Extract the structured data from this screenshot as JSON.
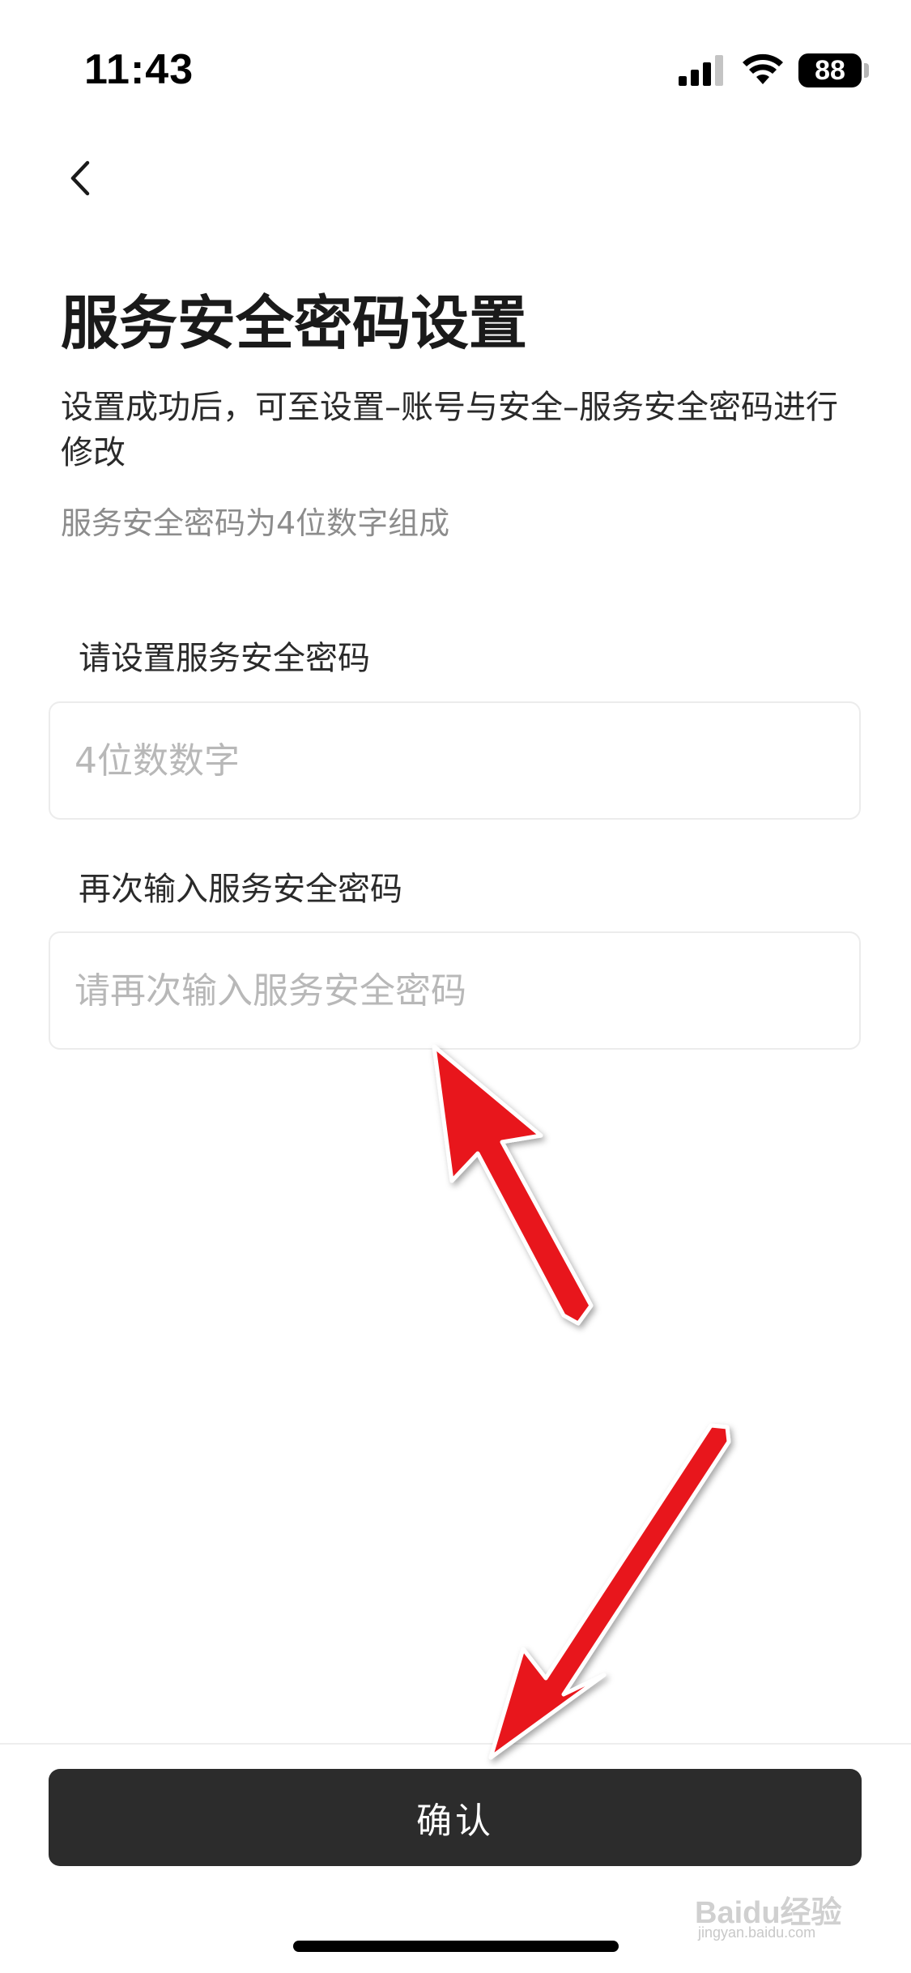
{
  "status_bar": {
    "time": "11:43",
    "battery": "88",
    "icons": [
      "signal-icon",
      "wifi-icon",
      "battery-icon"
    ]
  },
  "nav": {
    "back_icon": "chevron-left-icon"
  },
  "page": {
    "title": "服务安全密码设置",
    "description": "设置成功后，可至设置–账号与安全–服务安全密码进行修改",
    "hint": "服务安全密码为4位数字组成"
  },
  "form": {
    "field1": {
      "label": "请设置服务安全密码",
      "placeholder": "4位数数字",
      "value": ""
    },
    "field2": {
      "label": "再次输入服务安全密码",
      "placeholder": "请再次输入服务安全密码",
      "value": ""
    }
  },
  "footer": {
    "confirm_label": "确认"
  },
  "annotations": {
    "arrow_color": "#e8141b",
    "watermark_text": "Baidu经验",
    "watermark_subtext": "jingyan.baidu.com"
  }
}
